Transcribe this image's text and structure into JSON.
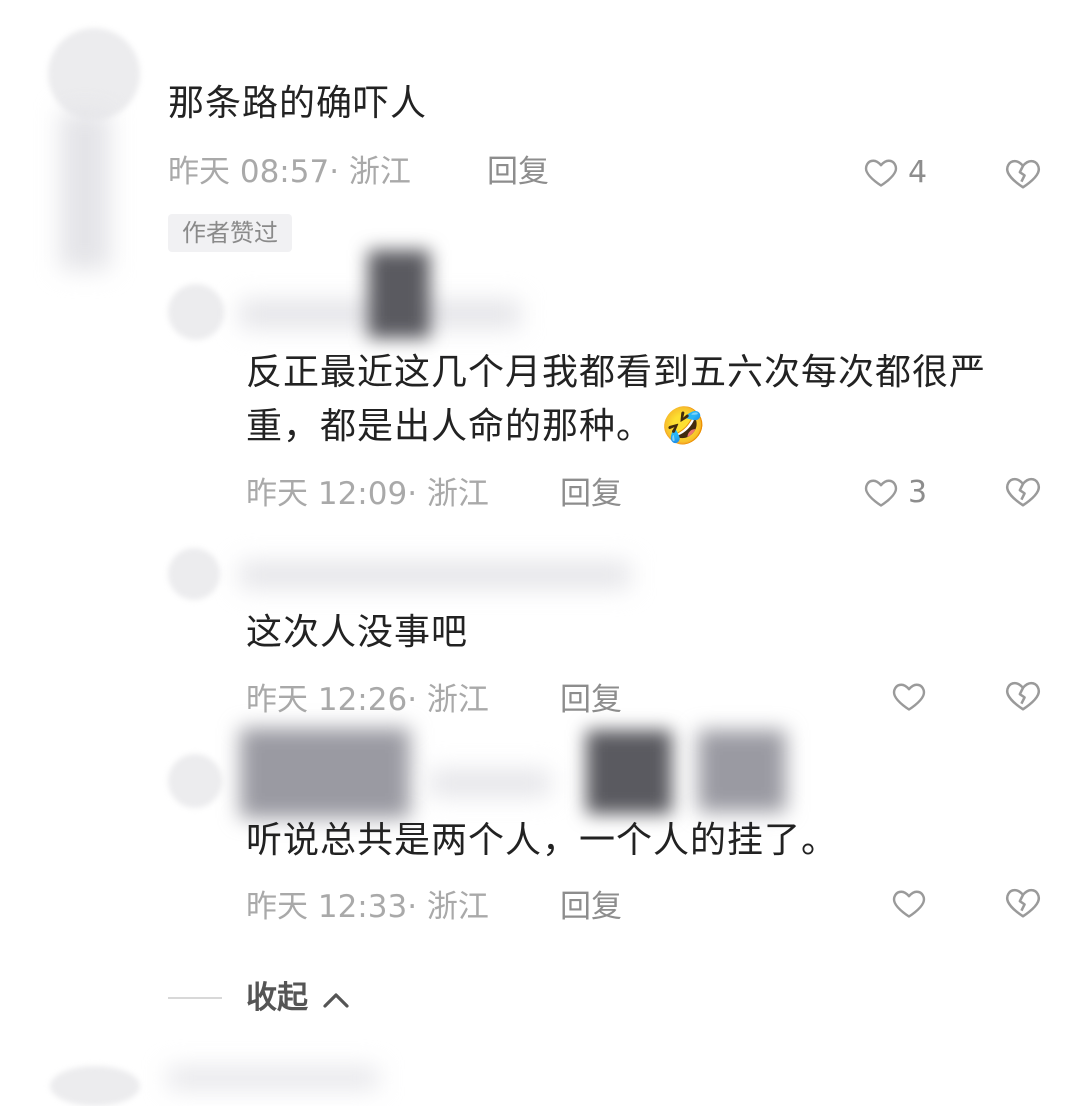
{
  "comments": [
    {
      "text": "那条路的确吓人",
      "time": "昨天 08:57",
      "location": "浙江",
      "reply_label": "回复",
      "likes": "4",
      "badge": "作者赞过"
    },
    {
      "text": "反正最近这几个月我都看到五六次每次都很严重，都是出人命的那种。",
      "emoji": "🤣",
      "time": "昨天 12:09",
      "location": "浙江",
      "reply_label": "回复",
      "likes": "3"
    },
    {
      "text": "这次人没事吧",
      "time": "昨天 12:26",
      "location": "浙江",
      "reply_label": "回复",
      "likes": ""
    },
    {
      "text": "听说总共是两个人，一个人的挂了。",
      "time": "昨天 12:33",
      "location": "浙江",
      "reply_label": "回复",
      "likes": ""
    }
  ],
  "meta_separator": "·",
  "collapse_label": "收起",
  "collapse_icon": "chevron-up-icon",
  "icons": {
    "like": "heart-outline-icon",
    "dislike": "broken-heart-icon"
  },
  "colors": {
    "text": "#222222",
    "meta": "#a9a9a9",
    "icon": "#9a9a9a"
  }
}
